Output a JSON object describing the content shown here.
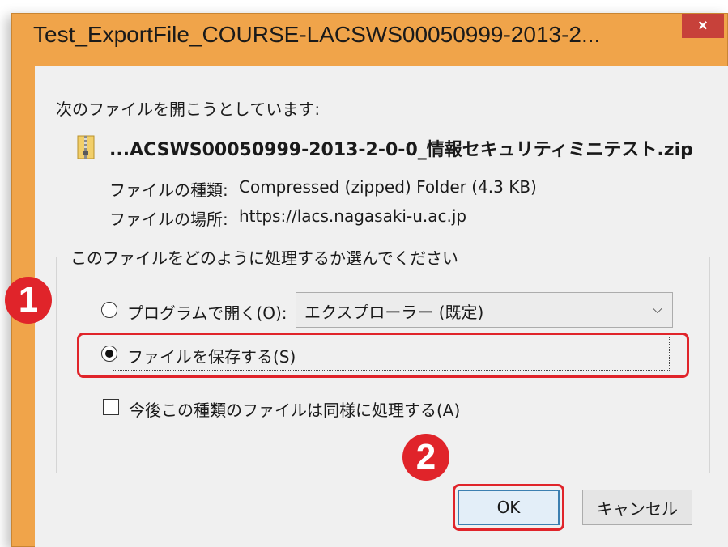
{
  "dialog": {
    "title": "Test_ExportFile_COURSE-LACSWS00050999-2013-2...",
    "close_glyph": "×",
    "prompt": "次のファイルを開こうとしています:",
    "file_name": "...ACSWS00050999-2013-2-0-0_情報セキュリティミニテスト.zip",
    "file_type_label": "ファイルの種類:",
    "file_type_value": "Compressed (zipped) Folder (4.3 KB)",
    "file_location_label": "ファイルの場所:",
    "file_location_value": "https://lacs.nagasaki-u.ac.jp",
    "file_icon": "zip-folder-icon"
  },
  "options": {
    "group_label": "このファイルをどのように処理するか選んでください",
    "open_with_label": "プログラムで開く(O):",
    "open_with_selected": "エクスプローラー (既定)",
    "save_file_label": "ファイルを保存する(S)",
    "save_file_checked": true,
    "remember_label": "今後この種類のファイルは同様に処理する(A)",
    "remember_checked": false
  },
  "buttons": {
    "ok_label": "OK",
    "cancel_label": "キャンセル"
  },
  "annotations": {
    "step1": "1",
    "step2": "2",
    "highlight_color": "#e0242a"
  }
}
